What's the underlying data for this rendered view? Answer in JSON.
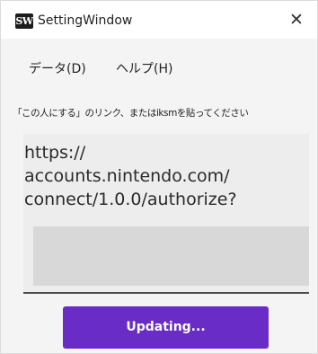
{
  "window": {
    "title": "SettingWindow",
    "icon_label": "SW",
    "close_glyph": "✕"
  },
  "menu": {
    "items": [
      {
        "label": "データ(D)"
      },
      {
        "label": "ヘルプ(H)"
      }
    ]
  },
  "instruction": "「この人にする」のリンク、またはiksmを貼ってください",
  "link_input": {
    "value": "https://\naccounts.nintendo.com/\nconnect/1.0.0/authorize?"
  },
  "update_button": {
    "label": "Updating...",
    "color": "#6a2cc7"
  }
}
